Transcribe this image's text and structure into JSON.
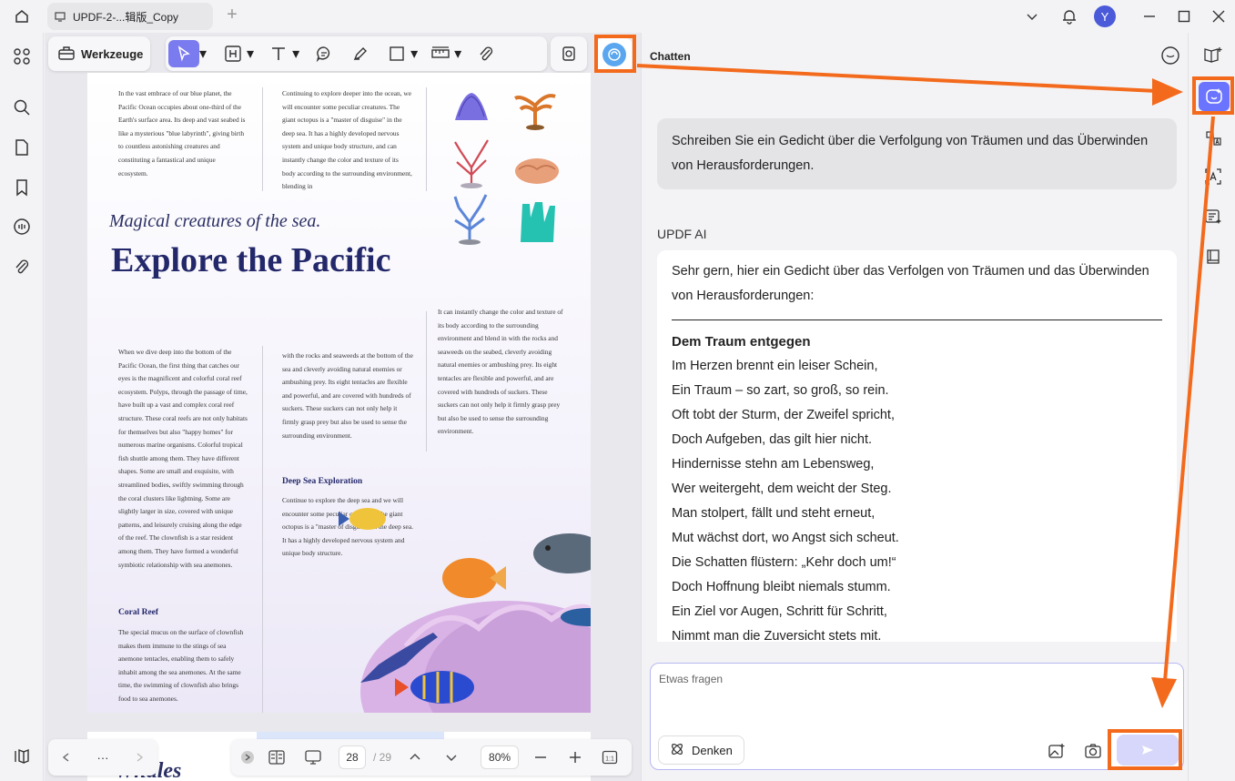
{
  "titlebar": {
    "tab_title": "UPDF-2-...辑版_Copy",
    "add_tab": "+",
    "avatar_letter": "Y"
  },
  "toolbar": {
    "tools_label": "Werkzeuge"
  },
  "document": {
    "col1_top": "In the vast embrace of our blue planet, the Pacific Ocean occupies about one-third of the Earth's surface area. Its deep and vast seabed is like a mysterious \"blue labyrinth\", giving birth to countless astonishing creatures and constituting a fantastical and unique ecosystem.",
    "col2_top": "Continuing to explore deeper into the ocean, we will encounter some peculiar creatures. The giant octopus is a \"master of disguise\" in the deep sea. It has a highly developed nervous system and unique body structure, and can instantly change the color and texture of its body according to the surrounding environment, blending in",
    "subtitle": "Magical creatures of the sea.",
    "title": "Explore the Pacific",
    "col3_mid": "It can instantly change the color and texture of its body according to the surrounding environment and blend in with the rocks and seaweeds on the seabed, cleverly avoiding natural enemies or ambushing prey. Its eight tentacles are flexible and powerful, and are covered with hundreds of suckers. These suckers can not only help it firmly grasp prey but also be used to sense the surrounding environment.",
    "col1_mid": "When we dive deep into the bottom of the Pacific Ocean, the first thing that catches our eyes is the magnificent and colorful coral reef ecosystem. Polyps, through the passage of time, have built up a vast and complex coral reef structure. These coral reefs are not only habitats for themselves but also \"happy homes\" for numerous marine organisms. Colorful tropical fish shuttle among them. They have different shapes. Some are small and exquisite, with streamlined bodies, swiftly swimming through the coral clusters like lightning. Some are slightly larger in size, covered with unique patterns, and leisurely cruising along the edge of the reef. The clownfish is a star resident among them. They have formed a wonderful symbiotic relationship with sea anemones.",
    "col2_mid": "with the rocks and seaweeds at the bottom of the sea and cleverly avoiding natural enemies or ambushing prey. Its eight tentacles are flexible and powerful, and are covered with hundreds of suckers. These suckers can not only help it firmly grasp prey but also be used to sense the surrounding environment.",
    "deep_sea_heading": "Deep Sea Exploration",
    "deep_sea_text": "Continue to explore the deep sea and we will encounter some peculiar creatures. The giant octopus is a \"master of disguise\" in the deep sea. It has a highly developed nervous system and unique body structure.",
    "coral_heading": "Coral Reef",
    "coral_text": "The special mucus on the surface of clownfish makes them immune to the stings of sea anemone tentacles, enabling them to safely inhabit among the sea anemones. At the same time, the swimming of clownfish also brings food to sea anemones.",
    "next_page_heading": "Whales"
  },
  "bottombar": {
    "more": "···",
    "page_current": "28",
    "page_total": "/ 29",
    "zoom": "80%"
  },
  "chat": {
    "title": "Chatten",
    "user_message": "Schreiben Sie ein Gedicht über die Verfolgung von Träumen und das Überwinden von Herausforderungen.",
    "ai_label": "UPDF AI",
    "ai_intro": "Sehr gern, hier ein Gedicht über das Verfolgen von Träumen und das Überwinden von Herausforderungen:",
    "poem_title": "Dem Traum entgegen",
    "poem_lines": [
      "Im Herzen brennt ein leiser Schein,",
      "Ein Traum – so zart, so groß, so rein.",
      "Oft tobt der Sturm, der Zweifel spricht,",
      "Doch Aufgeben, das gilt hier nicht.",
      "Hindernisse stehn am Lebensweg,",
      "Wer weitergeht, dem weicht der Steg.",
      "Man stolpert, fällt und steht erneut,",
      "Mut wächst dort, wo Angst sich scheut.",
      "Die Schatten flüstern: „Kehr doch um!“",
      "Doch Hoffnung bleibt niemals stumm.",
      "Ein Ziel vor Augen, Schritt für Schritt,",
      "Nimmt man die Zuversicht stets mit."
    ],
    "input_placeholder": "Etwas fragen",
    "think_label": "Denken"
  },
  "colors": {
    "accent": "#6b74ff",
    "highlight": "#f36a1c",
    "send_bg": "#d7d7fb"
  }
}
